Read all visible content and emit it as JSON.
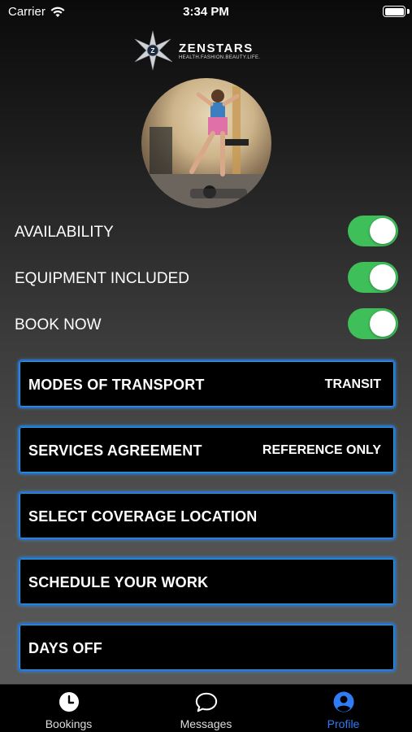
{
  "status_bar": {
    "carrier": "Carrier",
    "time": "3:34 PM"
  },
  "logo": {
    "name": "ZENSTARS",
    "tagline": "HEALTH.FASHION.BEAUTY.LIFE."
  },
  "toggles": [
    {
      "label": "AVAILABILITY",
      "on": true
    },
    {
      "label": "EQUIPMENT INCLUDED",
      "on": true
    },
    {
      "label": "BOOK NOW",
      "on": true
    }
  ],
  "menu": [
    {
      "label": "MODES OF TRANSPORT",
      "value": "TRANSIT"
    },
    {
      "label": "SERVICES AGREEMENT",
      "value": "REFERENCE ONLY"
    },
    {
      "label": "SELECT COVERAGE LOCATION",
      "value": ""
    },
    {
      "label": "SCHEDULE YOUR WORK",
      "value": ""
    },
    {
      "label": "DAYS OFF",
      "value": ""
    }
  ],
  "tabs": [
    {
      "label": "Bookings",
      "icon": "clock-icon",
      "active": false
    },
    {
      "label": "Messages",
      "icon": "chat-bubble-icon",
      "active": false
    },
    {
      "label": "Profile",
      "icon": "person-icon",
      "active": true
    }
  ],
  "colors": {
    "toggle_on": "#3fbf5a",
    "accent": "#2f7cf6",
    "card_border": "#2f6bd8"
  }
}
